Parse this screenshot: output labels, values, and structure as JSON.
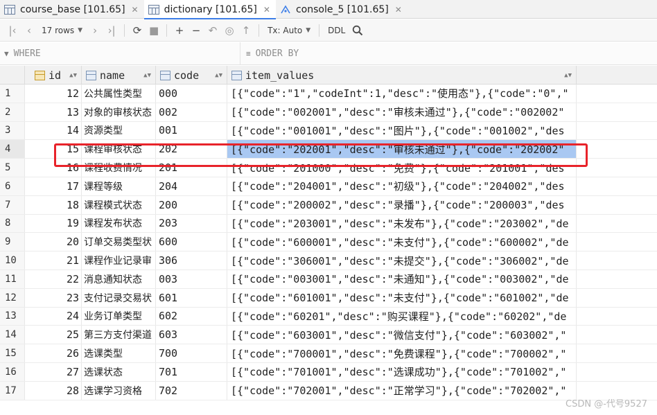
{
  "tabs": [
    {
      "label": "course_base [101.65]",
      "icon": "table-icon",
      "active": false
    },
    {
      "label": "dictionary [101.65]",
      "icon": "table-icon",
      "active": true
    },
    {
      "label": "console_5 [101.65]",
      "icon": "console-icon",
      "active": false
    }
  ],
  "toolbar": {
    "rows_label": "17 rows",
    "tx_label": "Tx: Auto",
    "ddl_label": "DDL"
  },
  "filter": {
    "where_label": "WHERE",
    "order_label": "ORDER BY"
  },
  "columns": [
    {
      "name": "id",
      "icon": "key-column-icon"
    },
    {
      "name": "name",
      "icon": "column-icon"
    },
    {
      "name": "code",
      "icon": "column-icon"
    },
    {
      "name": "item_values",
      "icon": "column-icon"
    }
  ],
  "rows": [
    {
      "num": "1",
      "id": "12",
      "name": "公共属性类型",
      "code": "000",
      "item_values": "[{\"code\":\"1\",\"codeInt\":1,\"desc\":\"使用态\"},{\"code\":\"0\",\""
    },
    {
      "num": "2",
      "id": "13",
      "name": "对象的审核状态",
      "code": "002",
      "item_values": "[{\"code\":\"002001\",\"desc\":\"审核未通过\"},{\"code\":\"002002\""
    },
    {
      "num": "3",
      "id": "14",
      "name": "资源类型",
      "code": "001",
      "item_values": "[{\"code\":\"001001\",\"desc\":\"图片\"},{\"code\":\"001002\",\"des"
    },
    {
      "num": "4",
      "id": "15",
      "name": "课程审核状态",
      "code": "202",
      "item_values": "[{\"code\":\"202001\",\"desc\":\"审核未通过\"},{\"code\":\"202002\"",
      "selected": true
    },
    {
      "num": "5",
      "id": "16",
      "name": "课程收费情况",
      "code": "201",
      "item_values": "[{\"code\":\"201000\",\"desc\":\"免费\"},{\"code\":\"201001\",\"des"
    },
    {
      "num": "6",
      "id": "17",
      "name": "课程等级",
      "code": "204",
      "item_values": "[{\"code\":\"204001\",\"desc\":\"初级\"},{\"code\":\"204002\",\"des"
    },
    {
      "num": "7",
      "id": "18",
      "name": "课程模式状态",
      "code": "200",
      "item_values": "[{\"code\":\"200002\",\"desc\":\"录播\"},{\"code\":\"200003\",\"des"
    },
    {
      "num": "8",
      "id": "19",
      "name": "课程发布状态",
      "code": "203",
      "item_values": "[{\"code\":\"203001\",\"desc\":\"未发布\"},{\"code\":\"203002\",\"de"
    },
    {
      "num": "9",
      "id": "20",
      "name": "订单交易类型状",
      "code": "600",
      "item_values": "[{\"code\":\"600001\",\"desc\":\"未支付\"},{\"code\":\"600002\",\"de"
    },
    {
      "num": "10",
      "id": "21",
      "name": "课程作业记录审",
      "code": "306",
      "item_values": "[{\"code\":\"306001\",\"desc\":\"未提交\"},{\"code\":\"306002\",\"de"
    },
    {
      "num": "11",
      "id": "22",
      "name": "消息通知状态",
      "code": "003",
      "item_values": "[{\"code\":\"003001\",\"desc\":\"未通知\"},{\"code\":\"003002\",\"de"
    },
    {
      "num": "12",
      "id": "23",
      "name": "支付记录交易状",
      "code": "601",
      "item_values": "[{\"code\":\"601001\",\"desc\":\"未支付\"},{\"code\":\"601002\",\"de"
    },
    {
      "num": "13",
      "id": "24",
      "name": "业务订单类型",
      "code": "602",
      "item_values": "[{\"code\":\"60201\",\"desc\":\"购买课程\"},{\"code\":\"60202\",\"de"
    },
    {
      "num": "14",
      "id": "25",
      "name": "第三方支付渠道",
      "code": "603",
      "item_values": "[{\"code\":\"603001\",\"desc\":\"微信支付\"},{\"code\":\"603002\",\""
    },
    {
      "num": "15",
      "id": "26",
      "name": "选课类型",
      "code": "700",
      "item_values": "[{\"code\":\"700001\",\"desc\":\"免费课程\"},{\"code\":\"700002\",\""
    },
    {
      "num": "16",
      "id": "27",
      "name": "选课状态",
      "code": "701",
      "item_values": "[{\"code\":\"701001\",\"desc\":\"选课成功\"},{\"code\":\"701002\",\""
    },
    {
      "num": "17",
      "id": "28",
      "name": "选课学习资格",
      "code": "702",
      "item_values": "[{\"code\":\"702001\",\"desc\":\"正常学习\"},{\"code\":\"702002\",\""
    }
  ],
  "watermark": "CSDN @-代号9527",
  "colors": {
    "accent": "#3d7ee8",
    "selection": "#a9c8f2",
    "highlight_box": "#e8232a"
  }
}
